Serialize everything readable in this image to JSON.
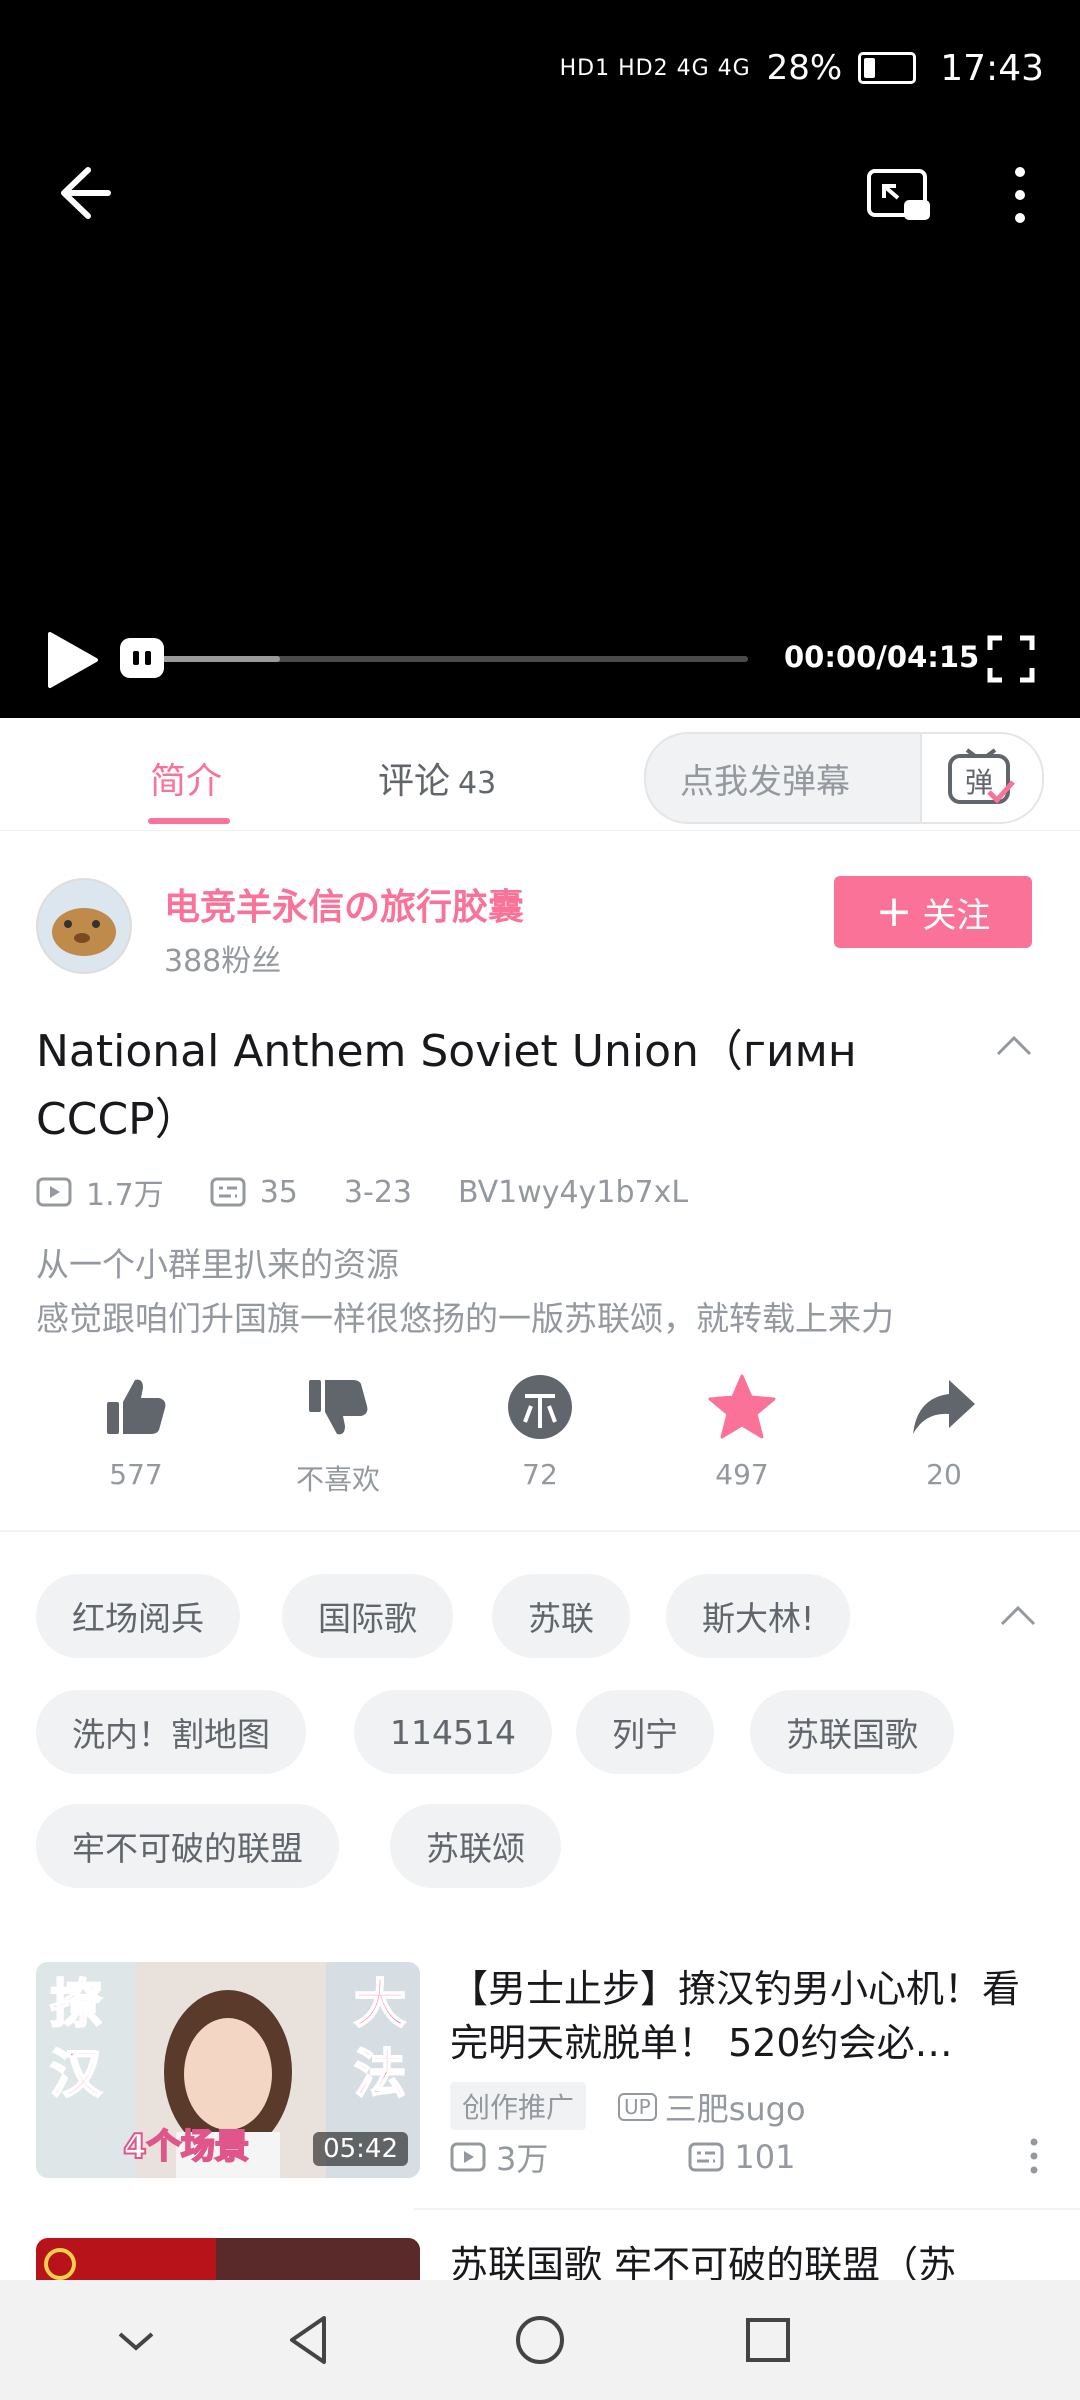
{
  "status_bar": {
    "signal_text": "HD1 HD2 4G 4G",
    "battery": "28%",
    "time": "17:43"
  },
  "player": {
    "timecode": "00:00/04:15",
    "progress_fraction": 0.0,
    "buffered_fraction": 0.22
  },
  "tabs": {
    "intro": "简介",
    "comments": "评论",
    "comments_count": "43",
    "danmaku_placeholder": "点我发弹幕",
    "danmaku_btn": "弹"
  },
  "uploader": {
    "name": "电竞羊永信の旅行胶囊",
    "fans": "388粉丝",
    "follow_label": "关注",
    "follow_plus": "+"
  },
  "video": {
    "title": "National Anthem Soviet Union（гимн СССР）",
    "views": "1.7万",
    "danmaku": "35",
    "date": "3-23",
    "bvid": "BV1wy4y1b7xL",
    "desc_line1": "从一个小群里扒来的资源",
    "desc_line2": "感觉跟咱们升国旗一样很悠扬的一版苏联颂，就转载上来力"
  },
  "actions": {
    "like": "577",
    "dislike": "不喜欢",
    "coin": "72",
    "favorite": "497",
    "share": "20"
  },
  "tags": [
    "红场阅兵",
    "国际歌",
    "苏联",
    "斯大林!",
    "洗内！割地图",
    "114514",
    "列宁",
    "苏联国歌",
    "牢不可破的联盟",
    "苏联颂"
  ],
  "recommendations": [
    {
      "title": "【男士止步】撩汉钓男小心机！看完明天就脱单！ 520约会必…",
      "duration": "05:42",
      "thumb_text_left": "撩汉",
      "thumb_text_right": "大法",
      "thumb_caption": "4个场景",
      "badge": "创作推广",
      "up_tag": "UP",
      "up_name": "三肥sugo",
      "views": "3万",
      "danmaku": "101"
    },
    {
      "title": "苏联国歌 牢不可破的联盟（苏"
    }
  ],
  "colors": {
    "accent": "#fb7299",
    "video_bg": "#000000",
    "secondary_text": "#9499a0",
    "tag_bg": "#f1f2f3"
  }
}
